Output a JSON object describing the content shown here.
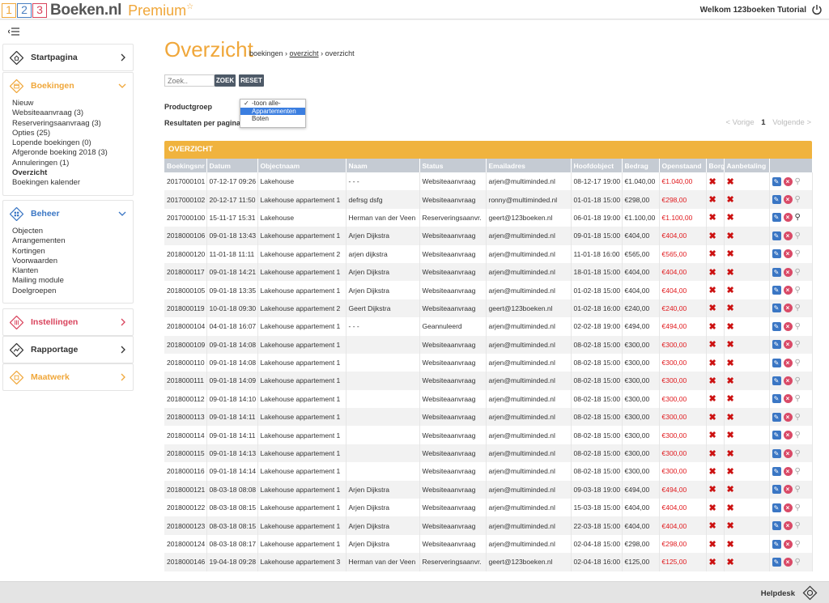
{
  "header": {
    "logo_digits": [
      "1",
      "2",
      "3"
    ],
    "brand": "Boeken.nl",
    "premium": "Premium",
    "premium_star": "☆",
    "welcome": "Welkom 123boeken Tutorial"
  },
  "sidebar": {
    "panels": [
      {
        "label": "Startpagina",
        "color": "#333333",
        "icon": "home-icon",
        "chevron": "right"
      },
      {
        "label": "Boekingen",
        "color": "#f0a73a",
        "icon": "calendar-icon",
        "chevron": "down",
        "items": [
          "Nieuw",
          "Websiteaanvraag (3)",
          "Reserveringsaanvraag (3)",
          "Opties (25)",
          "Lopende boekingen (0)",
          "Afgeronde boeking 2018 (3)",
          "Annuleringen (1)",
          "Overzicht",
          "Boekingen kalender"
        ],
        "active": "Overzicht"
      },
      {
        "label": "Beheer",
        "color": "#3a76c4",
        "icon": "manage-icon",
        "chevron": "down",
        "items": [
          "Objecten",
          "Arrangementen",
          "Kortingen",
          "Voorwaarden",
          "Klanten",
          "Mailing module",
          "Doelgroepen"
        ]
      },
      {
        "label": "Instellingen",
        "color": "#d9435c",
        "icon": "settings-icon",
        "chevron": "right"
      },
      {
        "label": "Rapportage",
        "color": "#333333",
        "icon": "report-icon",
        "chevron": "right"
      },
      {
        "label": "Maatwerk",
        "color": "#f0a73a",
        "icon": "custom-icon",
        "chevron": "right"
      }
    ]
  },
  "main": {
    "title": "Overzicht",
    "breadcrumb": [
      "boekingen",
      "overzicht",
      "overzicht"
    ],
    "search_placeholder": "Zoek..",
    "search_button": "ZOEK",
    "reset_button": "RESET",
    "productgroep_label": "Productgroep",
    "resultaten_label": "Resultaten per pagina",
    "dropdown_options": [
      "-toon alle-",
      "Appartementen",
      "Boten"
    ],
    "dropdown_selected": "Appartementen",
    "dropdown_checked": "-toon alle-",
    "pager": {
      "prev": "< Vorige",
      "page": "1",
      "next": "Volgende >"
    },
    "table_title": "OVERZICHT",
    "columns": [
      "Boekingsnr",
      "Datum",
      "Objectnaam",
      "Naam",
      "Status",
      "Emailadres",
      "Hoofdobject",
      "Bedrag",
      "Openstaand",
      "Borg",
      "Aanbetaling",
      ""
    ],
    "rows": [
      [
        "2017000101",
        "07-12-17 09:26",
        "Lakehouse",
        "- - -",
        "Websiteaanvraag",
        "arjen@multiminded.nl",
        "08-12-17 19:00",
        "€1.040,00",
        "€1.040,00",
        false
      ],
      [
        "2017000102",
        "20-12-17 11:50",
        "Lakehouse appartement 1",
        "defrsg dsfg",
        "Websiteaanvraag",
        "ronny@multiminded.nl",
        "01-01-18 15:00",
        "€298,00",
        "€298,00",
        false
      ],
      [
        "2017000100",
        "15-11-17 15:31",
        "Lakehouse",
        "Herman van der Veen",
        "Reserveringsaanvr.",
        "geert@123boeken.nl",
        "06-01-18 19:00",
        "€1.100,00",
        "€1.100,00",
        true
      ],
      [
        "2018000106",
        "09-01-18 13:43",
        "Lakehouse appartement 1",
        "Arjen Dijkstra",
        "Websiteaanvraag",
        "arjen@multiminded.nl",
        "09-01-18 15:00",
        "€404,00",
        "€404,00",
        false
      ],
      [
        "2018000120",
        "11-01-18 11:11",
        "Lakehouse appartement 2",
        "arjen dijkstra",
        "Websiteaanvraag",
        "arjen@multiminded.nl",
        "11-01-18 16:00",
        "€565,00",
        "€565,00",
        false
      ],
      [
        "2018000117",
        "09-01-18 14:21",
        "Lakehouse appartement 1",
        "Arjen Dijkstra",
        "Websiteaanvraag",
        "arjen@multiminded.nl",
        "18-01-18 15:00",
        "€404,00",
        "€404,00",
        false
      ],
      [
        "2018000105",
        "09-01-18 13:35",
        "Lakehouse appartement 1",
        "Arjen Dijkstra",
        "Websiteaanvraag",
        "arjen@multiminded.nl",
        "01-02-18 15:00",
        "€404,00",
        "€404,00",
        false
      ],
      [
        "2018000119",
        "10-01-18 09:30",
        "Lakehouse appartement 2",
        "Geert Dijkstra",
        "Websiteaanvraag",
        "geert@123boeken.nl",
        "01-02-18 16:00",
        "€240,00",
        "€240,00",
        false
      ],
      [
        "2018000104",
        "04-01-18 16:07",
        "Lakehouse appartement 1",
        "- - -",
        "Geannuleerd",
        "arjen@multiminded.nl",
        "02-02-18 19:00",
        "€494,00",
        "€494,00",
        false
      ],
      [
        "2018000109",
        "09-01-18 14:08",
        "Lakehouse appartement 1",
        "",
        "Websiteaanvraag",
        "arjen@multiminded.nl",
        "08-02-18 15:00",
        "€300,00",
        "€300,00",
        false
      ],
      [
        "2018000110",
        "09-01-18 14:08",
        "Lakehouse appartement 1",
        "",
        "Websiteaanvraag",
        "arjen@multiminded.nl",
        "08-02-18 15:00",
        "€300,00",
        "€300,00",
        false
      ],
      [
        "2018000111",
        "09-01-18 14:09",
        "Lakehouse appartement 1",
        "",
        "Websiteaanvraag",
        "arjen@multiminded.nl",
        "08-02-18 15:00",
        "€300,00",
        "€300,00",
        false
      ],
      [
        "2018000112",
        "09-01-18 14:10",
        "Lakehouse appartement 1",
        "",
        "Websiteaanvraag",
        "arjen@multiminded.nl",
        "08-02-18 15:00",
        "€300,00",
        "€300,00",
        false
      ],
      [
        "2018000113",
        "09-01-18 14:11",
        "Lakehouse appartement 1",
        "",
        "Websiteaanvraag",
        "arjen@multiminded.nl",
        "08-02-18 15:00",
        "€300,00",
        "€300,00",
        false
      ],
      [
        "2018000114",
        "09-01-18 14:11",
        "Lakehouse appartement 1",
        "",
        "Websiteaanvraag",
        "arjen@multiminded.nl",
        "08-02-18 15:00",
        "€300,00",
        "€300,00",
        false
      ],
      [
        "2018000115",
        "09-01-18 14:13",
        "Lakehouse appartement 1",
        "",
        "Websiteaanvraag",
        "arjen@multiminded.nl",
        "08-02-18 15:00",
        "€300,00",
        "€300,00",
        false
      ],
      [
        "2018000116",
        "09-01-18 14:14",
        "Lakehouse appartement 1",
        "",
        "Websiteaanvraag",
        "arjen@multiminded.nl",
        "08-02-18 15:00",
        "€300,00",
        "€300,00",
        false
      ],
      [
        "2018000121",
        "08-03-18 08:08",
        "Lakehouse appartement 1",
        "Arjen Dijkstra",
        "Websiteaanvraag",
        "arjen@multiminded.nl",
        "09-03-18 19:00",
        "€494,00",
        "€494,00",
        false
      ],
      [
        "2018000122",
        "08-03-18 08:15",
        "Lakehouse appartement 1",
        "Arjen Dijkstra",
        "Websiteaanvraag",
        "arjen@multiminded.nl",
        "15-03-18 15:00",
        "€404,00",
        "€404,00",
        false
      ],
      [
        "2018000123",
        "08-03-18 08:15",
        "Lakehouse appartement 1",
        "Arjen Dijkstra",
        "Websiteaanvraag",
        "arjen@multiminded.nl",
        "22-03-18 15:00",
        "€404,00",
        "€404,00",
        false
      ],
      [
        "2018000124",
        "08-03-18 08:17",
        "Lakehouse appartement 1",
        "Arjen Dijkstra",
        "Websiteaanvraag",
        "arjen@multiminded.nl",
        "02-04-18 15:00",
        "€298,00",
        "€298,00",
        false
      ],
      [
        "2018000146",
        "19-04-18 09:28",
        "Lakehouse appartement 3",
        "Herman van der Veen",
        "Reserveringsaanvr.",
        "geert@123boeken.nl",
        "02-04-18 16:00",
        "€125,00",
        "€125,00",
        false
      ]
    ]
  },
  "footer": {
    "helpdesk": "Helpdesk"
  }
}
